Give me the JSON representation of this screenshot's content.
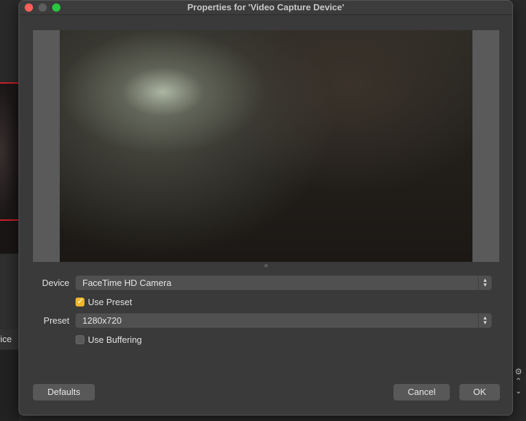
{
  "background_app": {
    "partial_label": "vice"
  },
  "window": {
    "title": "Properties for 'Video Capture Device'"
  },
  "form": {
    "device_label": "Device",
    "device_value": "FaceTime HD Camera",
    "use_preset_label": "Use Preset",
    "use_preset_checked": true,
    "preset_label": "Preset",
    "preset_value": "1280x720",
    "use_buffering_label": "Use Buffering",
    "use_buffering_checked": false
  },
  "buttons": {
    "defaults": "Defaults",
    "cancel": "Cancel",
    "ok": "OK"
  },
  "colors": {
    "checkbox_accent": "#f1b72a",
    "close": "#ff5f57",
    "zoom": "#28c840",
    "live_border": "#d0202a"
  },
  "icons": {
    "select_stepper": "updown-chevron-icon",
    "checkmark": "check-icon"
  }
}
